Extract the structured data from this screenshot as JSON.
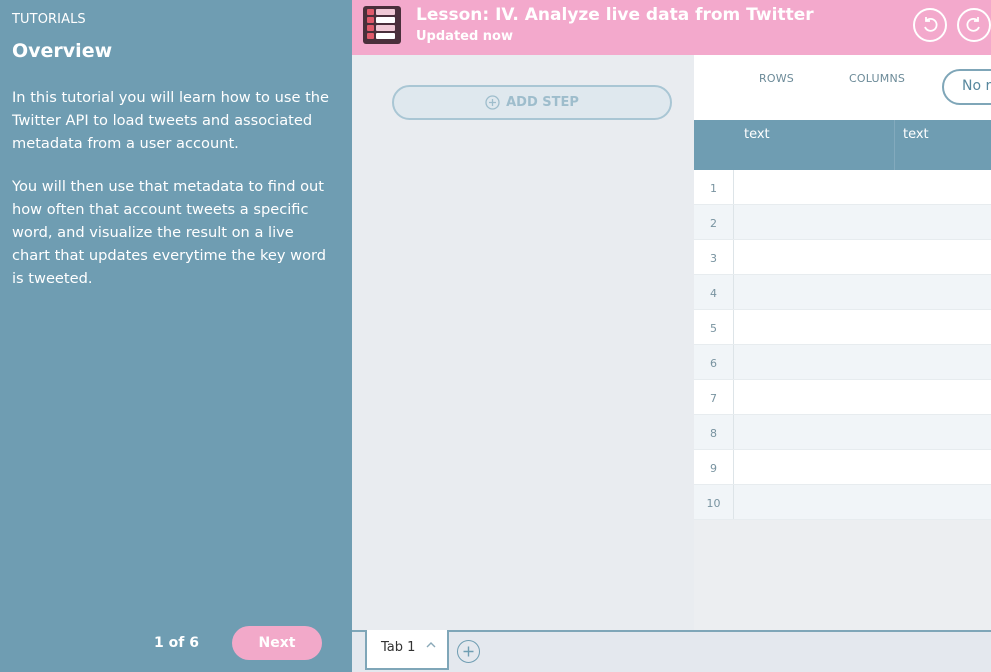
{
  "tutorial": {
    "kicker": "TUTORIALS",
    "title": "Overview",
    "paragraphs": [
      "In this tutorial you will learn how to use the Twitter API to load tweets and associated metadata from a user account.",
      "You will then use that metadata to find out how often that account tweets a specific word, and visualize the result on a live chart that updates everytime the key word is tweeted."
    ],
    "page_indicator": "1 of 6",
    "next_label": "Next"
  },
  "header": {
    "title": "Lesson: IV. Analyze live data from Twitter",
    "subtitle": "Updated now",
    "icons": [
      "lesson-icon",
      "undo-icon",
      "redo-icon"
    ]
  },
  "steps": {
    "add_step_label": "ADD STEP"
  },
  "table": {
    "rows_label": "ROWS",
    "columns_label": "COLUMNS",
    "no_rows_label": "No rows",
    "columns": [
      "text",
      "text"
    ],
    "row_numbers": [
      "1",
      "2",
      "3",
      "4",
      "5",
      "6",
      "7",
      "8",
      "9",
      "10"
    ]
  },
  "tabs": {
    "items": [
      {
        "label": "Tab 1"
      }
    ]
  },
  "colors": {
    "sidebar": "#6f9db2",
    "header": "#f3a9cc",
    "next_button": "#f2a9c9",
    "accent": "#7fa6b8"
  }
}
